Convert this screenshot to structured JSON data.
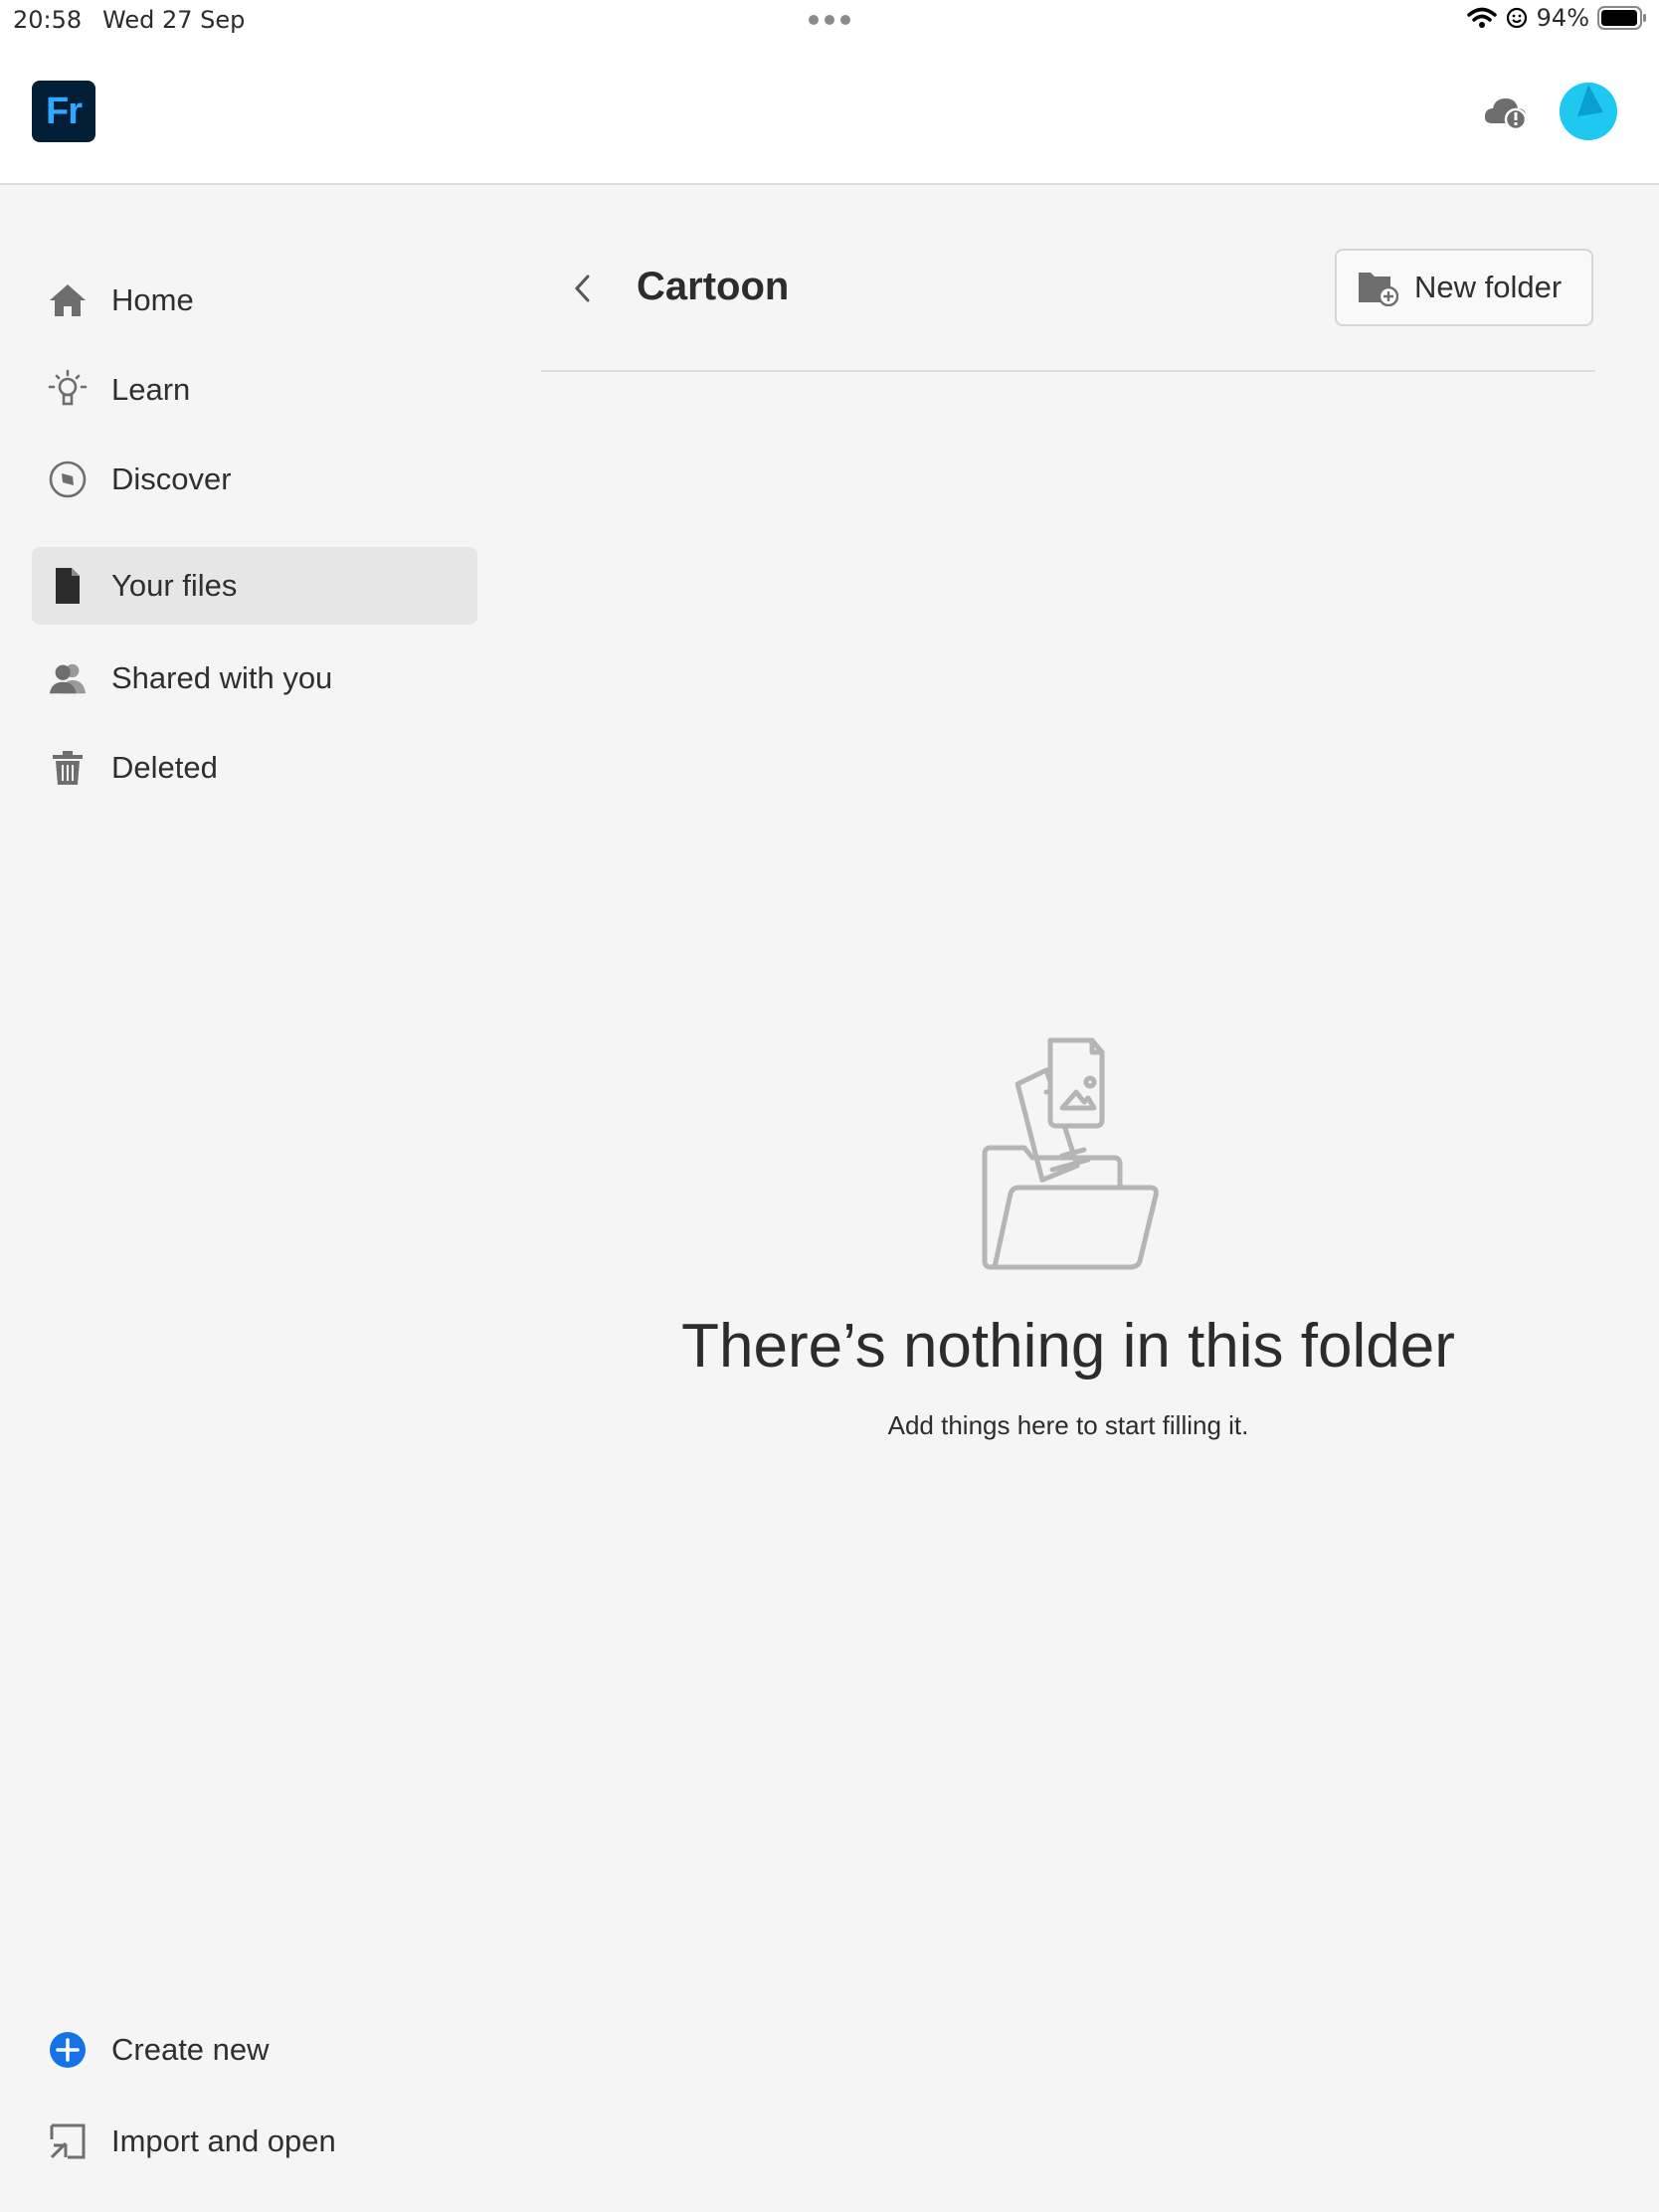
{
  "status_bar": {
    "time": "20:58",
    "date": "Wed 27 Sep",
    "battery": "94%"
  },
  "app": {
    "logo_text": "Fr",
    "accent": "#31a8ff",
    "logo_bg": "#001e36"
  },
  "sidebar": {
    "items": [
      {
        "label": "Home",
        "icon": "home-icon"
      },
      {
        "label": "Learn",
        "icon": "lightbulb-icon"
      },
      {
        "label": "Discover",
        "icon": "compass-icon"
      },
      {
        "label": "Your files",
        "icon": "document-icon",
        "active": true
      },
      {
        "label": "Shared with you",
        "icon": "people-icon"
      },
      {
        "label": "Deleted",
        "icon": "trash-icon"
      }
    ],
    "bottom": [
      {
        "label": "Create new",
        "icon": "plus-circle-icon"
      },
      {
        "label": "Import and open",
        "icon": "import-icon"
      }
    ]
  },
  "main": {
    "title": "Cartoon",
    "new_folder_label": "New folder",
    "empty_title": "There’s nothing in this folder",
    "empty_subtitle": "Add things here to start filling it."
  }
}
